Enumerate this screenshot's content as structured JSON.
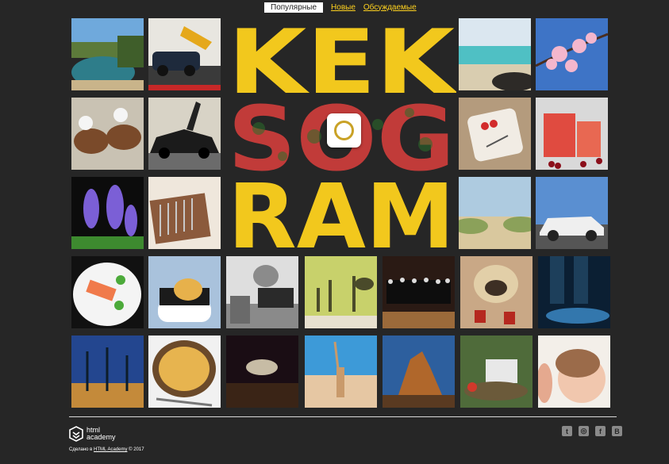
{
  "filters": [
    {
      "label": "Популярные",
      "active": true
    },
    {
      "label": "Новые",
      "active": false
    },
    {
      "label": "Обсуждаемые",
      "active": false
    }
  ],
  "logo": {
    "lines": [
      "KEK",
      "SOG",
      "RAM"
    ],
    "colors": {
      "yellow": "#f2c81d",
      "dark": "#1d1d1d"
    }
  },
  "photos": [
    "lake-coast",
    "car-excavator",
    "",
    "",
    "",
    "beach-rocks",
    "cherry-blossom",
    "sake-bottles-bath",
    "black-sportscar",
    "",
    "",
    "",
    "strawberry-plate",
    "red-drink-currants",
    "hyacinth-flowers",
    "cutlery-drawer",
    "",
    "",
    "",
    "dunes-path",
    "white-audi",
    "salmon-plate",
    "sushi-cat",
    "shark-slippers",
    "giraffe-wall",
    "choir-stage",
    "pug-socks",
    "neon-legs",
    "palm-trees-night",
    "pasta-bowl",
    "concert-crowd",
    "beach-girl",
    "desert-rock",
    "offroad-jeep",
    "baby-face"
  ],
  "footer": {
    "academy_line1": "html",
    "academy_line2": "academy",
    "copyright_prefix": "Сделано в",
    "copyright_link": "HTML Academy",
    "copyright_suffix": "© 2017",
    "socials": [
      {
        "icon": "twitter-icon",
        "glyph": "t"
      },
      {
        "icon": "instagram-icon",
        "glyph": "◎"
      },
      {
        "icon": "facebook-icon",
        "glyph": "f"
      },
      {
        "icon": "vk-icon",
        "glyph": "В"
      }
    ]
  }
}
